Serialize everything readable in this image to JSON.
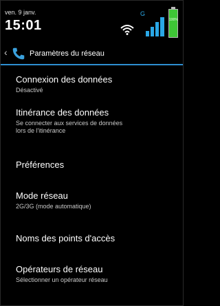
{
  "status": {
    "date": "ven. 9 janv.",
    "time": "15:01",
    "network_type": "G",
    "battery_label": "100%"
  },
  "actionbar": {
    "title": "Paramètres du réseau",
    "back_icon": "chevron-left-icon",
    "app_icon": "phone-icon",
    "accent": "#2e8fd1"
  },
  "items": [
    {
      "title": "Connexion des données",
      "subtitle": "Désactivé"
    },
    {
      "title": "Itinérance des données",
      "subtitle": "Se connecter aux services de données lors de l'itinérance"
    },
    {
      "title": "Préférences",
      "subtitle": ""
    },
    {
      "title": "Mode réseau",
      "subtitle": "2G/3G (mode automatique)"
    },
    {
      "title": "Noms des points d'accès",
      "subtitle": ""
    },
    {
      "title": "Opérateurs de réseau",
      "subtitle": "Sélectionner un opérateur réseau"
    }
  ]
}
